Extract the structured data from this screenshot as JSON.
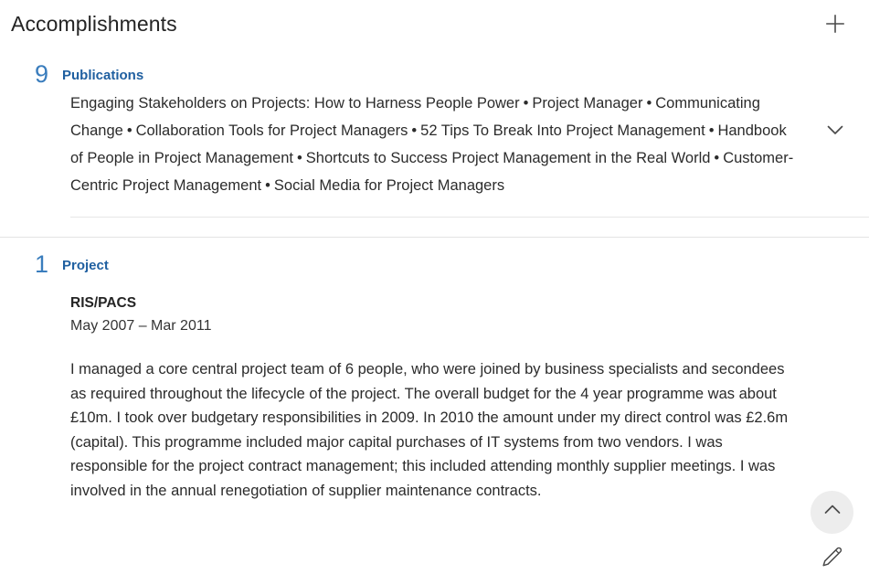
{
  "header": {
    "title": "Accomplishments",
    "add_icon": "plus-icon"
  },
  "sections": [
    {
      "count": "9",
      "label": "Publications",
      "toggle_icon": "chevron-down-icon",
      "separator": "•",
      "publications": [
        "Engaging Stakeholders on Projects: How to Harness People Power",
        "Project Manager",
        "Communicating Change",
        "Collaboration Tools for Project Managers",
        "52 Tips To Break Into Project Management",
        "Handbook of People in Project Management",
        "Shortcuts to Success Project Management in the Real World",
        "Customer-Centric Project Management",
        "Social Media for Project Managers"
      ]
    },
    {
      "count": "1",
      "label": "Project",
      "toggle_icon": "chevron-up-icon",
      "edit_icon": "pencil-icon",
      "project_title": "RIS/PACS",
      "project_dates": "May 2007 – Mar 2011",
      "project_description": "I managed a core central project team of 6 people, who were joined by business specialists and secondees as required throughout the lifecycle of the project. The overall budget for the 4 year programme was about £10m. I took over budgetary responsibilities in 2009. In 2010 the amount under my direct control was £2.6m (capital). This programme included major capital purchases of IT systems from two vendors. I was responsible for the project contract management; this included attending monthly supplier meetings. I was involved in the annual renegotiation of supplier maintenance contracts."
    }
  ],
  "colors": {
    "accent_label": "#1f5fa0",
    "accent_count": "#3a7dbd",
    "text": "#2b2b2b",
    "divider": "#e6e6e6",
    "hover_circle": "#ededed"
  }
}
